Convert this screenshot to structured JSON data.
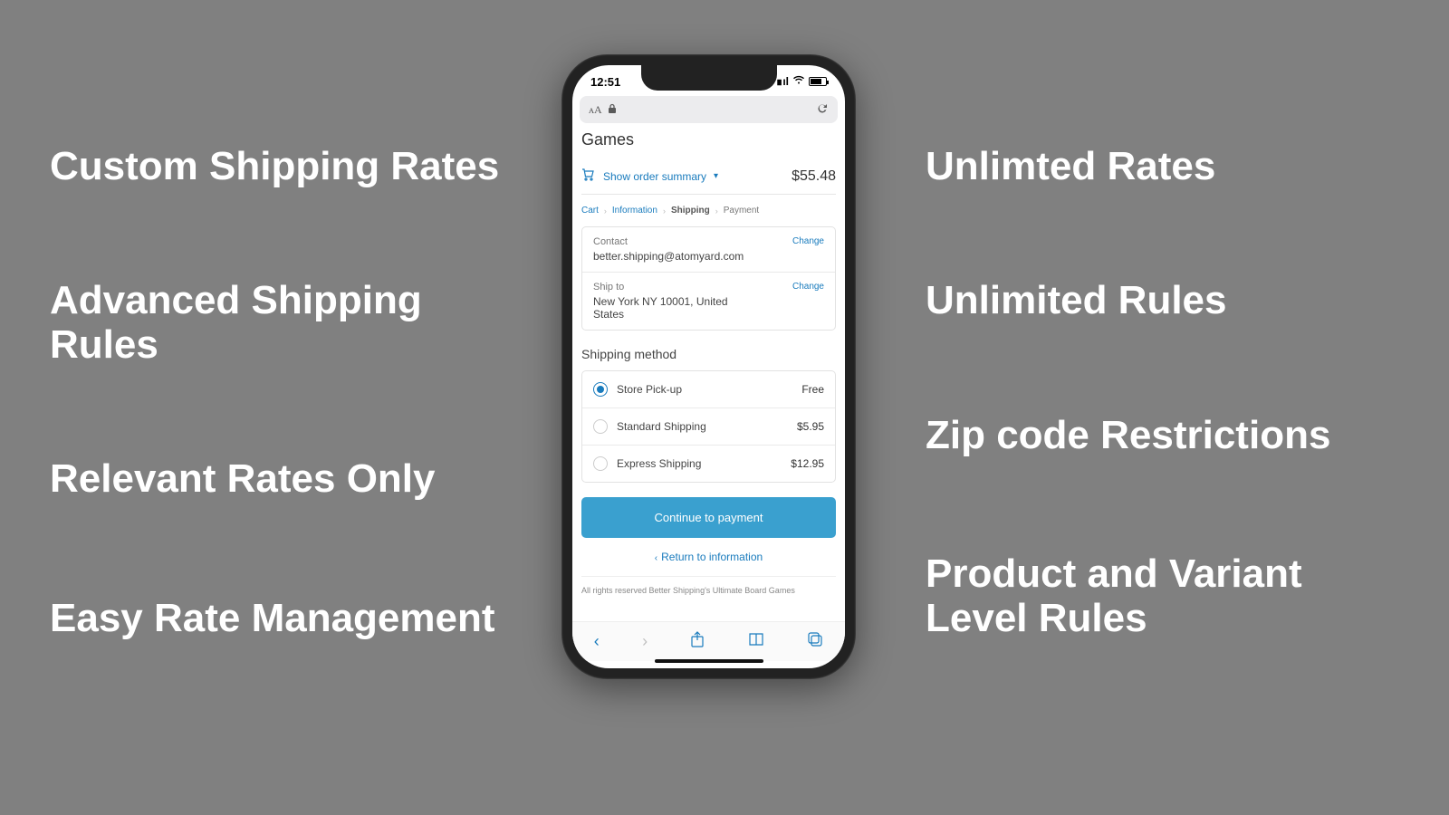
{
  "features_left": [
    "Custom Shipping Rates",
    "Advanced Shipping Rules",
    "Relevant Rates Only",
    "Easy Rate Management"
  ],
  "features_right": [
    "Unlimted Rates",
    "Unlimited Rules",
    "Zip code Restrictions",
    "Product and Variant Level Rules"
  ],
  "phone": {
    "status_time": "12:51",
    "store_title": "Games",
    "summary": {
      "toggle_label": "Show order summary",
      "total": "$55.48"
    },
    "breadcrumbs": {
      "cart": "Cart",
      "info": "Information",
      "shipping": "Shipping",
      "payment": "Payment"
    },
    "contact": {
      "label": "Contact",
      "value": "better.shipping@atomyard.com",
      "change": "Change"
    },
    "shipto": {
      "label": "Ship to",
      "value": "New York NY 10001, United States",
      "change": "Change"
    },
    "method_header": "Shipping method",
    "methods": [
      {
        "label": "Store Pick-up",
        "price": "Free"
      },
      {
        "label": "Standard Shipping",
        "price": "$5.95"
      },
      {
        "label": "Express Shipping",
        "price": "$12.95"
      }
    ],
    "cta": "Continue to payment",
    "return": "Return to information",
    "footer": "All rights reserved Better Shipping's Ultimate Board Games"
  }
}
